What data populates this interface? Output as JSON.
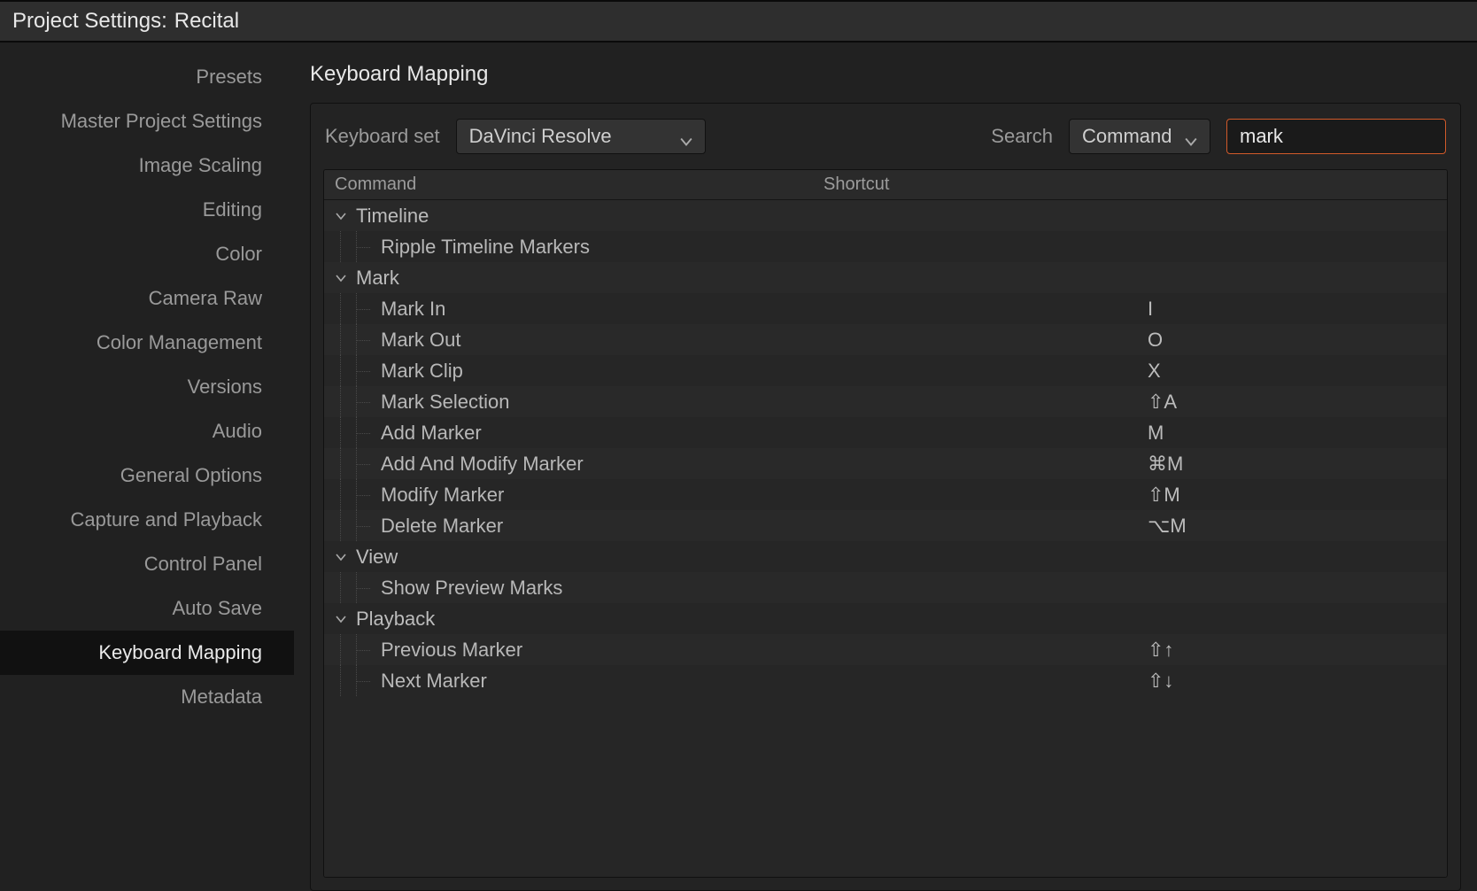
{
  "window": {
    "title_prefix": "Project Settings:",
    "project_name": "Recital"
  },
  "sidebar": {
    "items": [
      {
        "label": "Presets"
      },
      {
        "label": "Master Project Settings"
      },
      {
        "label": "Image Scaling"
      },
      {
        "label": "Editing"
      },
      {
        "label": "Color"
      },
      {
        "label": "Camera Raw"
      },
      {
        "label": "Color Management"
      },
      {
        "label": "Versions"
      },
      {
        "label": "Audio"
      },
      {
        "label": "General Options"
      },
      {
        "label": "Capture and Playback"
      },
      {
        "label": "Control Panel"
      },
      {
        "label": "Auto Save"
      },
      {
        "label": "Keyboard Mapping"
      },
      {
        "label": "Metadata"
      }
    ],
    "active_index": 13
  },
  "main": {
    "title": "Keyboard Mapping",
    "controls": {
      "set_label": "Keyboard set",
      "set_value": "DaVinci Resolve",
      "search_label": "Search",
      "search_mode": "Command",
      "search_value": "mark"
    },
    "table": {
      "columns": {
        "command": "Command",
        "shortcut": "Shortcut"
      },
      "groups": [
        {
          "name": "Timeline",
          "items": [
            {
              "command": "Ripple Timeline Markers",
              "shortcut": ""
            }
          ]
        },
        {
          "name": "Mark",
          "items": [
            {
              "command": "Mark In",
              "shortcut": "I"
            },
            {
              "command": "Mark Out",
              "shortcut": "O"
            },
            {
              "command": "Mark Clip",
              "shortcut": "X"
            },
            {
              "command": "Mark Selection",
              "shortcut": "⇧A"
            },
            {
              "command": "Add Marker",
              "shortcut": "M"
            },
            {
              "command": "Add And Modify Marker",
              "shortcut": "⌘M"
            },
            {
              "command": "Modify Marker",
              "shortcut": "⇧M"
            },
            {
              "command": "Delete Marker",
              "shortcut": "⌥M"
            }
          ]
        },
        {
          "name": "View",
          "items": [
            {
              "command": "Show Preview Marks",
              "shortcut": ""
            }
          ]
        },
        {
          "name": "Playback",
          "items": [
            {
              "command": "Previous Marker",
              "shortcut": "⇧↑"
            },
            {
              "command": "Next Marker",
              "shortcut": "⇧↓"
            }
          ]
        }
      ]
    }
  }
}
